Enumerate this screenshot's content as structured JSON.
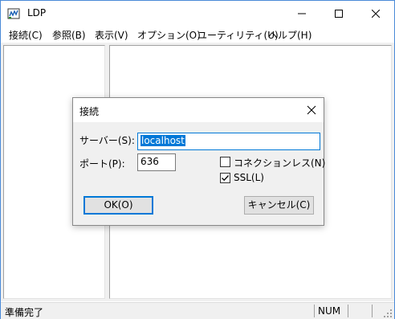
{
  "window": {
    "title": "LDP",
    "icon": "ldp-app-icon",
    "controls": [
      "minimize-icon",
      "maximize-icon",
      "close-icon"
    ]
  },
  "menu": [
    {
      "label": "接続(C)"
    },
    {
      "label": "参照(B)"
    },
    {
      "label": "表示(V)"
    },
    {
      "label": "オプション(O)"
    },
    {
      "label": "ユーティリティ(U)"
    },
    {
      "label": "ヘルプ(H)"
    }
  ],
  "status": {
    "text": "準備完了",
    "num": "NUM"
  },
  "dialog": {
    "title": "接続",
    "server_label": "サーバー(S):",
    "server_value": "localhost",
    "port_label": "ポート(P):",
    "port_value": "636",
    "connectionless_label": "コネクションレス(N)",
    "connectionless_checked": false,
    "ssl_label": "SSL(L)",
    "ssl_checked": true,
    "ok_label": "OK(O)",
    "cancel_label": "キャンセル(C)"
  },
  "colors": {
    "accent": "#0078d7",
    "window_border": "#4a8ad8",
    "chrome": "#f0f0f0"
  }
}
